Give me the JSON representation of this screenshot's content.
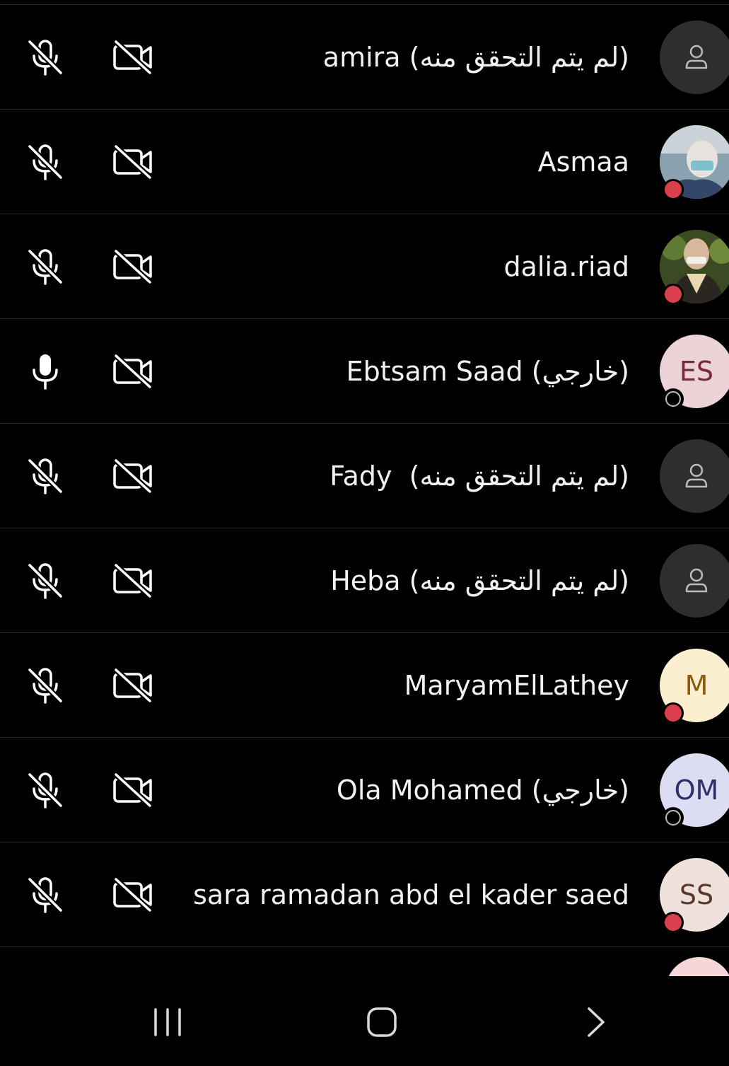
{
  "participants": [
    {
      "name": "amira (لم يتم التحقق منه)",
      "mic": "muted",
      "camera": "off",
      "avatar": {
        "type": "placeholder",
        "icon": "person-icon",
        "bg": "#2e2e2e"
      },
      "status": null
    },
    {
      "name": "Asmaa",
      "mic": "muted",
      "camera": "off",
      "avatar": {
        "type": "photo",
        "bg": "#8aa1b0"
      },
      "status": "busy"
    },
    {
      "name": "dalia.riad",
      "mic": "muted",
      "camera": "off",
      "avatar": {
        "type": "photo",
        "bg": "#4e5a2e"
      },
      "status": "busy"
    },
    {
      "name": "Ebtsam Saad (خارجي)",
      "mic": "on",
      "camera": "off",
      "avatar": {
        "type": "initials",
        "initials": "ES",
        "bg": "#ecd3d7",
        "fg": "#7a2a3a"
      },
      "status": "offline"
    },
    {
      "name": "Fady  (لم يتم التحقق منه)",
      "mic": "muted",
      "camera": "off",
      "avatar": {
        "type": "placeholder",
        "icon": "person-icon",
        "bg": "#2e2e2e"
      },
      "status": null
    },
    {
      "name": "Heba (لم يتم التحقق منه)",
      "mic": "muted",
      "camera": "off",
      "avatar": {
        "type": "placeholder",
        "icon": "person-icon",
        "bg": "#2e2e2e"
      },
      "status": null
    },
    {
      "name": "MaryamElLathey",
      "mic": "muted",
      "camera": "off",
      "avatar": {
        "type": "initials",
        "initials": "M",
        "bg": "#fbefcf",
        "fg": "#8a5a10"
      },
      "status": "busy"
    },
    {
      "name": "Ola Mohamed (خارجي)",
      "mic": "muted",
      "camera": "off",
      "avatar": {
        "type": "initials",
        "initials": "OM",
        "bg": "#dcdcf2",
        "fg": "#2e2e6a"
      },
      "status": "offline"
    },
    {
      "name": "sara ramadan abd el kader saed",
      "mic": "muted",
      "camera": "off",
      "avatar": {
        "type": "initials",
        "initials": "SS",
        "bg": "#efe1db",
        "fg": "#5a3a30"
      },
      "status": "busy"
    }
  ],
  "colors": {
    "background": "#000000",
    "divider": "#2b2b2b",
    "text": "#f2f2f2",
    "busy": "#d93f4c"
  },
  "navbar": {
    "recents": "recents-icon",
    "home": "home-icon",
    "back": "back-icon"
  }
}
